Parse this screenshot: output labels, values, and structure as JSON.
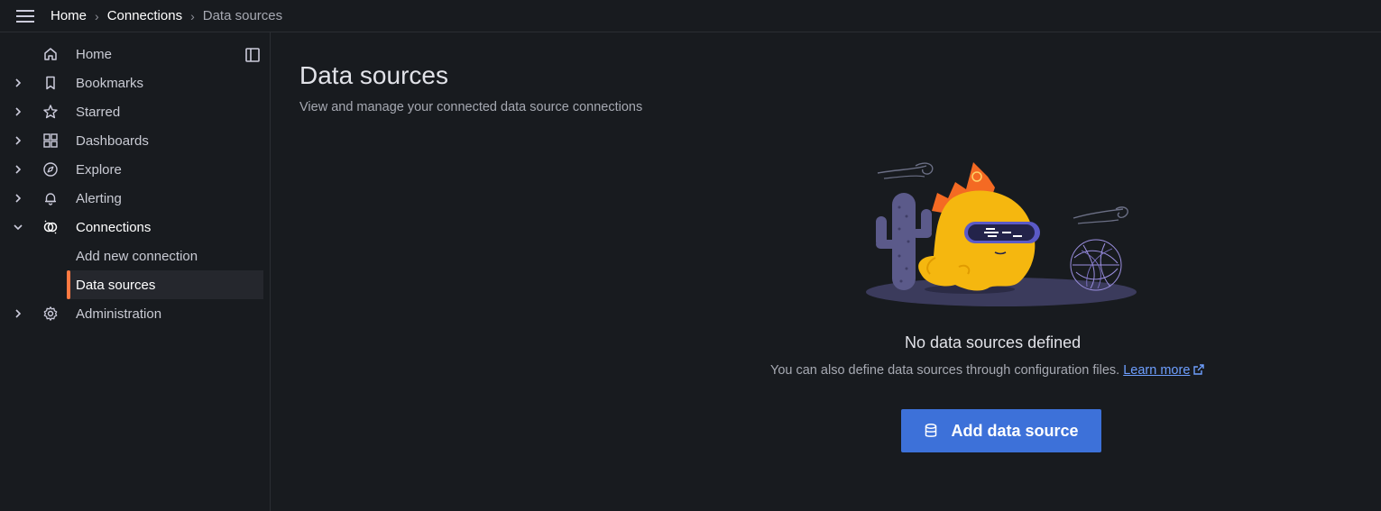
{
  "breadcrumb": {
    "home": "Home",
    "connections": "Connections",
    "current": "Data sources"
  },
  "sidebar": {
    "items": [
      {
        "label": "Home",
        "icon": "home-icon"
      },
      {
        "label": "Bookmarks",
        "icon": "bookmark-icon"
      },
      {
        "label": "Starred",
        "icon": "star-icon"
      },
      {
        "label": "Dashboards",
        "icon": "dashboards-icon"
      },
      {
        "label": "Explore",
        "icon": "compass-icon"
      },
      {
        "label": "Alerting",
        "icon": "bell-icon"
      },
      {
        "label": "Connections",
        "icon": "connections-icon"
      },
      {
        "label": "Administration",
        "icon": "gear-icon"
      }
    ],
    "sub_items": [
      {
        "label": "Add new connection"
      },
      {
        "label": "Data sources"
      }
    ]
  },
  "main": {
    "title": "Data sources",
    "subtitle": "View and manage your connected data source connections",
    "empty": {
      "title": "No data sources defined",
      "description": "You can also define data sources through configuration files.",
      "link": "Learn more",
      "button": "Add data source"
    }
  },
  "colors": {
    "accent": "#ff7941",
    "primary_button": "#3d71d9",
    "link": "#6e9fff",
    "background": "#181b1f"
  }
}
